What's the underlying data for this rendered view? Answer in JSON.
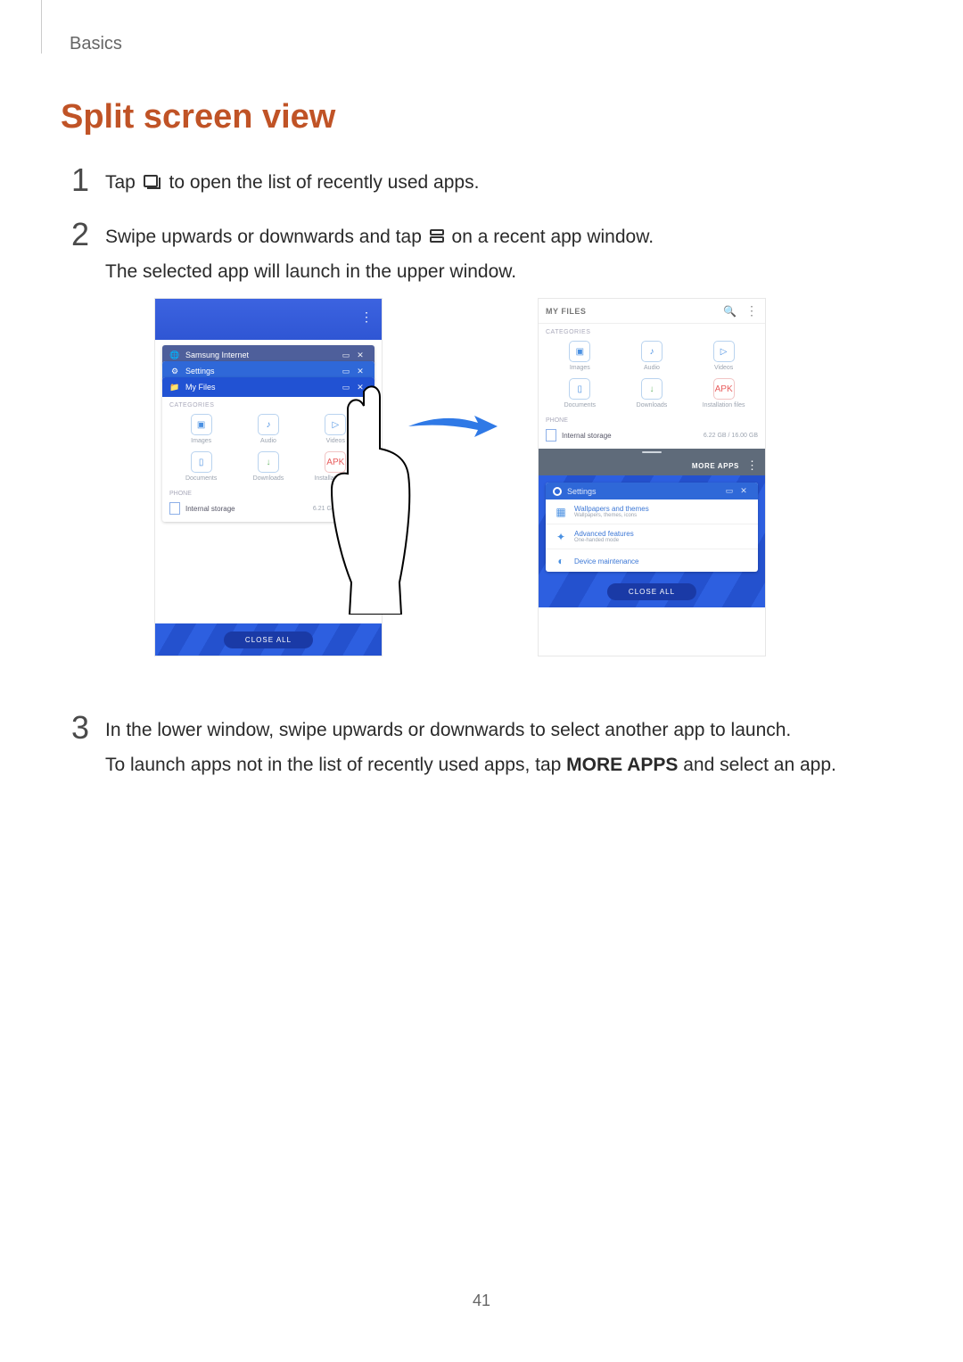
{
  "breadcrumb": "Basics",
  "heading": "Split screen view",
  "page_number": "41",
  "steps": {
    "one": {
      "num": "1",
      "pre": "Tap ",
      "post": " to open the list of recently used apps."
    },
    "two": {
      "num": "2",
      "line1_pre": "Swipe upwards or downwards and tap ",
      "line1_post": " on a recent app window.",
      "line2": "The selected app will launch in the upper window."
    },
    "three": {
      "num": "3",
      "line1": "In the lower window, swipe upwards or downwards to select another app to launch.",
      "line2_pre": "To launch apps not in the list of recently used apps, tap ",
      "line2_bold": "MORE APPS",
      "line2_post": " and select an app."
    }
  },
  "phones": {
    "left": {
      "recents": [
        {
          "title": "Samsung Internet"
        },
        {
          "title": "Settings"
        },
        {
          "title": "My Files"
        }
      ],
      "myfiles": {
        "categories_label": "CATEGORIES",
        "grid_row1": [
          {
            "icon": "image",
            "label": "Images"
          },
          {
            "icon": "music",
            "label": "Audio"
          },
          {
            "icon": "video",
            "label": "Videos"
          }
        ],
        "grid_row2": [
          {
            "icon": "document",
            "label": "Documents"
          },
          {
            "icon": "download",
            "label": "Downloads"
          },
          {
            "icon": "apk",
            "label": "Installation files"
          }
        ],
        "phone_label": "PHONE",
        "storage_label": "Internal storage",
        "storage_usage": "6.21 GB / 16.00 GB"
      },
      "close_all": "CLOSE ALL"
    },
    "right": {
      "upper": {
        "title": "MY FILES",
        "categories_label": "CATEGORIES",
        "grid_row1": [
          {
            "icon": "image",
            "label": "Images"
          },
          {
            "icon": "music",
            "label": "Audio"
          },
          {
            "icon": "video",
            "label": "Videos"
          }
        ],
        "grid_row2": [
          {
            "icon": "document",
            "label": "Documents"
          },
          {
            "icon": "download",
            "label": "Downloads"
          },
          {
            "icon": "apk",
            "label": "Installation files"
          }
        ],
        "phone_label": "PHONE",
        "storage_label": "Internal storage",
        "storage_usage": "6.22 GB / 16.00 GB"
      },
      "more_apps": "MORE APPS",
      "lower_card": {
        "title": "Settings",
        "rows": [
          {
            "title": "Wallpapers and themes",
            "sub": "Wallpapers, themes, icons"
          },
          {
            "title": "Advanced features",
            "sub": "One-handed mode"
          },
          {
            "title": "Device maintenance",
            "sub": ""
          }
        ]
      },
      "close_all": "CLOSE ALL"
    }
  }
}
